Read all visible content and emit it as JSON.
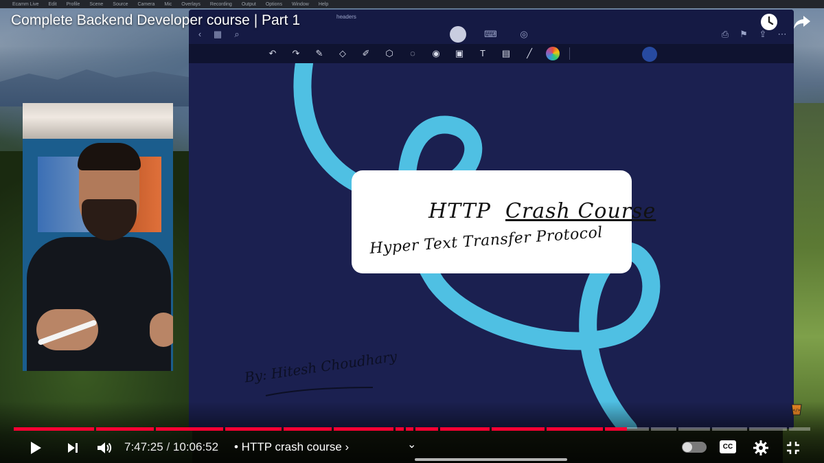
{
  "video": {
    "title": "Complete Backend Developer course | Part 1"
  },
  "top_actions": {
    "watch_later": "clock-icon",
    "share": "share-icon"
  },
  "mac_menubar": {
    "items": [
      "Ecamm Live",
      "Edit",
      "Profile",
      "Scene",
      "Source",
      "Camera",
      "Mic",
      "Overlays",
      "Recording",
      "Output",
      "Options",
      "Window",
      "Help"
    ]
  },
  "notes_app": {
    "tab_label": "headers"
  },
  "whiteboard": {
    "title_word1": "HTTP",
    "title_word2": "Crash Course",
    "subtitle": "Hyper Text Transfer Protocol",
    "byline": "By: Hitesh Choudhary"
  },
  "player": {
    "current_time": "7:47:25",
    "separator": " / ",
    "duration": "10:06:52",
    "chapter": "• HTTP crash course ›",
    "captions_label": "CC",
    "progress_fraction": 0.77,
    "accent_color": "#ff0033"
  }
}
